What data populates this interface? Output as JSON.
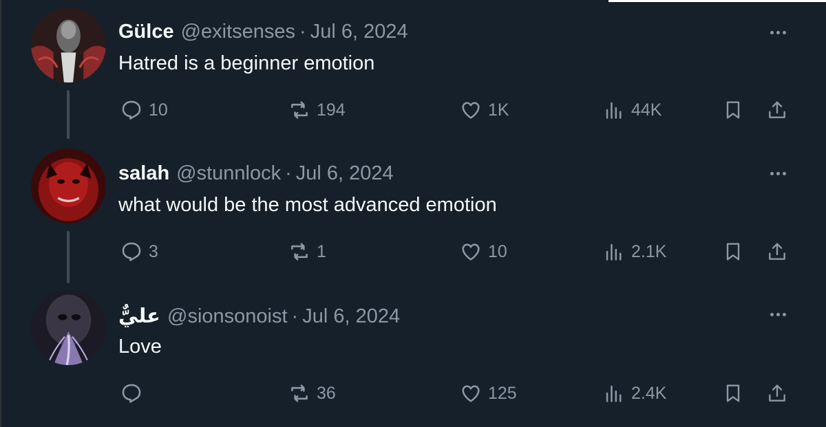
{
  "tweets": [
    {
      "display_name": "Gülce",
      "handle": "@exitsenses",
      "separator": "·",
      "date": "Jul 6, 2024",
      "text": "Hatred is a beginner emotion",
      "replies": "10",
      "reposts": "194",
      "likes": "1K",
      "views": "44K"
    },
    {
      "display_name": "salah",
      "handle": "@stunnlock",
      "separator": "·",
      "date": "Jul 6, 2024",
      "text": "what would be the most advanced emotion",
      "replies": "3",
      "reposts": "1",
      "likes": "10",
      "views": "2.1K"
    },
    {
      "display_name": "عليٌّ",
      "handle": "@sionsonoist",
      "separator": "·",
      "date": "Jul 6, 2024",
      "text": "Love",
      "replies": "",
      "reposts": "36",
      "likes": "125",
      "views": "2.4K"
    }
  ],
  "icons": {
    "reply": "reply-icon",
    "repost": "repost-icon",
    "like": "heart-icon",
    "views": "views-icon",
    "bookmark": "bookmark-icon",
    "share": "share-icon",
    "more": "more-dots-icon"
  },
  "colors": {
    "background": "#15202b",
    "primary_text": "#f7f9f9",
    "secondary_text": "#8b98a5",
    "thread_line": "#3e4c5a"
  }
}
